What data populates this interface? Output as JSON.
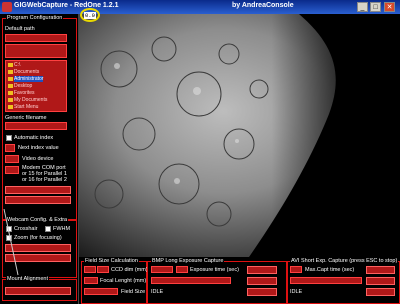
{
  "window": {
    "title_left": "GIGWebCapture - RedOne 1.2.1",
    "title_right": "by AndreaConsole",
    "buttons": [
      "_",
      "□",
      "✕"
    ]
  },
  "overlay": {
    "zoom_readout": "0.0"
  },
  "left": {
    "program_config": "Program Configuration",
    "default_path": "Default path",
    "tree_items": [
      "C:\\",
      "Documents",
      "Administrator",
      "Desktop",
      "Favorites",
      "My Documents",
      "Start Menu"
    ],
    "generic_filename": "Generic filename",
    "automatic_index": "Automatic index",
    "next_index_value": "Next index value",
    "video_device": "Video device",
    "modem_line1": "Modem COM port",
    "modem_line2": "or 15 for Parallel 1",
    "modem_line3": "or 16 for Parallel 2",
    "webcam_config": "Webcam Config. & Extra",
    "crosshair": "Crosshair",
    "fwhm": "FWHM",
    "zoom_focusing": "Zoom (for focusing)",
    "mount_alignment": "Mount Alignment"
  },
  "bottom": {
    "field_size_calc": "Field Size Calculation",
    "ccd_dim": "CCD dim (mm)",
    "focal_length": "Focal Lenght (mm)",
    "field_size": "Field Size",
    "bmp_long": "BMP Long Exposure Capture",
    "exposure_time": "Exposure time (sec)",
    "idle1": "IDLE",
    "avi_short": "AVI Short Exp. Capture (press ESC to stop)",
    "max_capt": "Max.Capt time (sec)",
    "idle2": "IDLE"
  }
}
